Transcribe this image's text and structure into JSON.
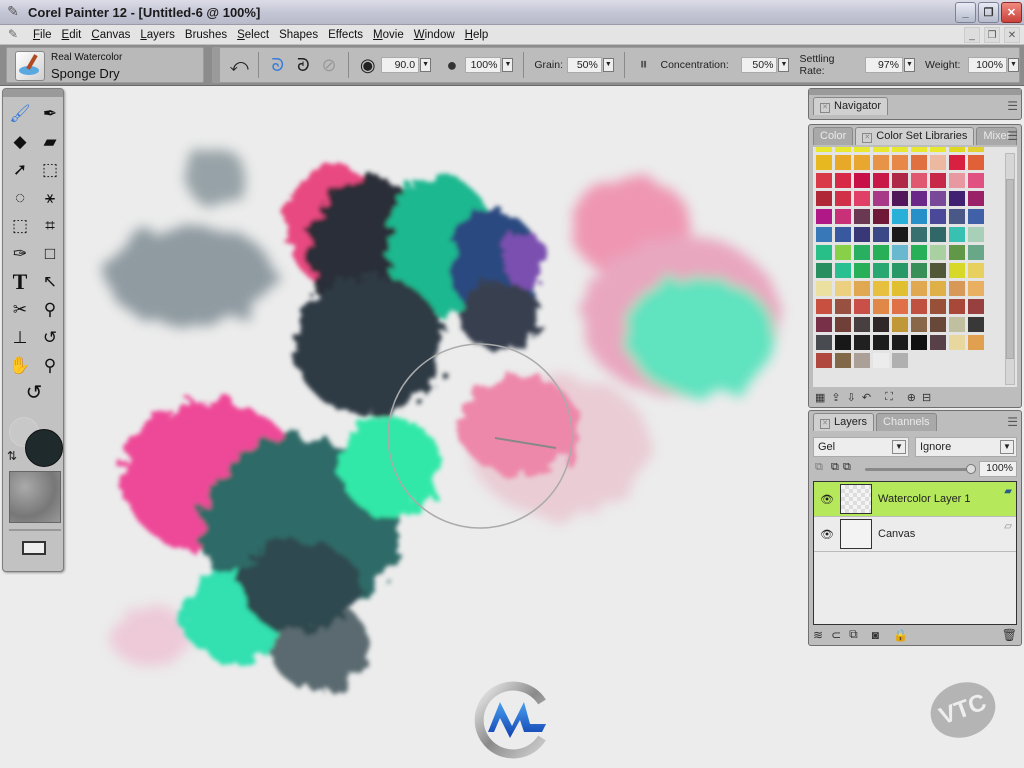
{
  "window": {
    "title": "Corel Painter 12 - [Untitled-6 @ 100%]",
    "controls": {
      "minimize": "_",
      "restore": "❐",
      "close": "✕"
    }
  },
  "menubar": {
    "items": [
      {
        "label": "File",
        "u": "F",
        "rest": "ile"
      },
      {
        "label": "Edit",
        "u": "E",
        "rest": "dit"
      },
      {
        "label": "Canvas",
        "u": "C",
        "rest": "anvas"
      },
      {
        "label": "Layers",
        "u": "L",
        "rest": "ayers"
      },
      {
        "label": "Brushes",
        "u": "",
        "rest": "Brushes"
      },
      {
        "label": "Select",
        "u": "S",
        "rest": "elect"
      },
      {
        "label": "Shapes",
        "u": "",
        "rest": "Shapes"
      },
      {
        "label": "Effects",
        "u": "",
        "rest": "Effects"
      },
      {
        "label": "Movie",
        "u": "M",
        "rest": "ovie"
      },
      {
        "label": "Window",
        "u": "W",
        "rest": "indow"
      },
      {
        "label": "Help",
        "u": "H",
        "rest": "elp"
      }
    ]
  },
  "property_bar": {
    "brush_category": "Real Watercolor",
    "brush_variant": "Sponge Dry",
    "angle_value": "90.0",
    "opacity_value": "100%",
    "grain_label": "Grain:",
    "grain_value": "50%",
    "concentration_label": "Concentration:",
    "concentration_value": "50%",
    "settling_label": "Settling Rate:",
    "settling_value": "97%",
    "weight_label": "Weight:",
    "weight_value": "100%"
  },
  "navigator_panel": {
    "tab": "Navigator"
  },
  "color_panel": {
    "tabs": [
      "Color",
      "Color Set Libraries",
      "Mixer"
    ],
    "active_tab": "Color Set Libraries",
    "swatches": [
      "#e8e830",
      "#e8e830",
      "#e8e830",
      "#e8e830",
      "#e8e830",
      "#e8e830",
      "#e8e830",
      "#e0d820",
      "#e0d030",
      "#e8b820",
      "#e8a828",
      "#e8a830",
      "#e89448",
      "#e88848",
      "#e07040",
      "#ecb8a0",
      "#d82040",
      "#e06038",
      "#d83848",
      "#d82848",
      "#c81048",
      "#c81848",
      "#b02848",
      "#e05870",
      "#c82848",
      "#e898a0",
      "#e05080",
      "#b02838",
      "#d03048",
      "#e04068",
      "#a83888",
      "#501858",
      "#6a2888",
      "#7a4898",
      "#402070",
      "#9a2068",
      "#b01888",
      "#c83078",
      "#6a3850",
      "#701838",
      "#28b0d8",
      "#2890c8",
      "#4a4898",
      "#4a5888",
      "#4060a8",
      "#3878b8",
      "#3858a0",
      "#383878",
      "#3a4888",
      "#1a1a1a",
      "#387070",
      "#306868",
      "#38c0b0",
      "#a8d0b8",
      "#28c088",
      "#88d048",
      "#28b060",
      "#28b058",
      "#68b8d0",
      "#28b058",
      "#a8d0a0",
      "#609848",
      "#68a888",
      "#289060",
      "#28c090",
      "#28b058",
      "#28a870",
      "#289868",
      "#389058",
      "#505838",
      "#d8d828",
      "#e8d060",
      "#ece0a0",
      "#ecd080",
      "#e0a850",
      "#e8c040",
      "#e0c030",
      "#e0a850",
      "#e0b048",
      "#d89858",
      "#e8b060",
      "#c85040",
      "#985040",
      "#c85048",
      "#e08848",
      "#e07048",
      "#c05040",
      "#985038",
      "#a84838",
      "#984040",
      "#783048",
      "#704038",
      "#484040",
      "#302828",
      "#c09838",
      "#886848",
      "#684838",
      "#c0c0a0",
      "#383838",
      "#484c50",
      "#181818",
      "#202020",
      "#1c1c1c",
      "#1c1c1c",
      "#101010",
      "#584048",
      "#e8d8a0",
      "#e0a050",
      "#b04840",
      "#806848",
      "#aaa098",
      "#ececec",
      "#b0b0b0"
    ]
  },
  "layers_panel": {
    "tabs": [
      "Layers",
      "Channels"
    ],
    "composite_method": "Gel",
    "composite_depth": "Ignore",
    "opacity": "100%",
    "opacity_fraction": 1.0,
    "layers": [
      {
        "name": "Watercolor Layer 1",
        "selected": true,
        "visible": true
      },
      {
        "name": "Canvas",
        "selected": false,
        "visible": true
      }
    ]
  },
  "watermarks": {
    "vtc": "VTC"
  },
  "colors": {
    "selected_layer": "#b5e85a",
    "main_color": "#1f2a2c",
    "active_tool": "#3b7dd8"
  }
}
